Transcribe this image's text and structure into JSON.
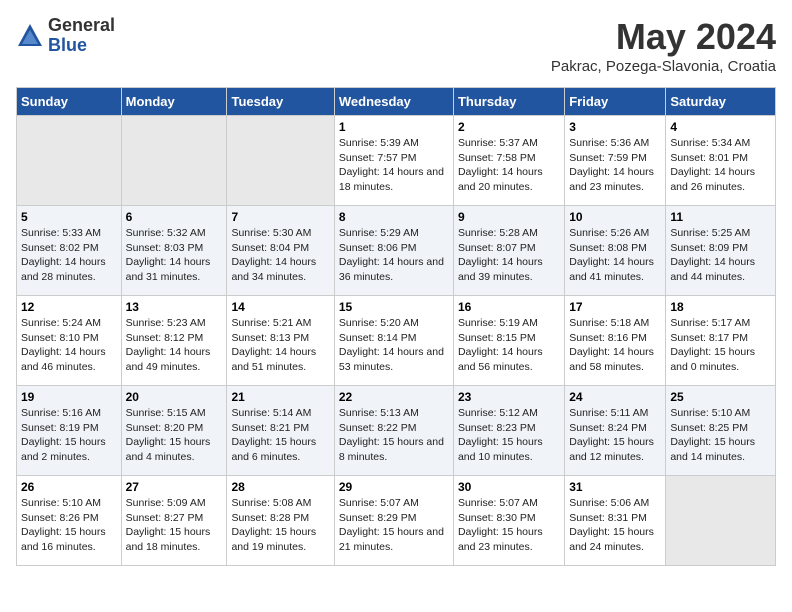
{
  "header": {
    "logo_general": "General",
    "logo_blue": "Blue",
    "title": "May 2024",
    "subtitle": "Pakrac, Pozega-Slavonia, Croatia"
  },
  "days_of_week": [
    "Sunday",
    "Monday",
    "Tuesday",
    "Wednesday",
    "Thursday",
    "Friday",
    "Saturday"
  ],
  "weeks": [
    [
      {
        "day": "",
        "empty": true
      },
      {
        "day": "",
        "empty": true
      },
      {
        "day": "",
        "empty": true
      },
      {
        "day": "1",
        "sunrise": "Sunrise: 5:39 AM",
        "sunset": "Sunset: 7:57 PM",
        "daylight": "Daylight: 14 hours and 18 minutes."
      },
      {
        "day": "2",
        "sunrise": "Sunrise: 5:37 AM",
        "sunset": "Sunset: 7:58 PM",
        "daylight": "Daylight: 14 hours and 20 minutes."
      },
      {
        "day": "3",
        "sunrise": "Sunrise: 5:36 AM",
        "sunset": "Sunset: 7:59 PM",
        "daylight": "Daylight: 14 hours and 23 minutes."
      },
      {
        "day": "4",
        "sunrise": "Sunrise: 5:34 AM",
        "sunset": "Sunset: 8:01 PM",
        "daylight": "Daylight: 14 hours and 26 minutes."
      }
    ],
    [
      {
        "day": "5",
        "sunrise": "Sunrise: 5:33 AM",
        "sunset": "Sunset: 8:02 PM",
        "daylight": "Daylight: 14 hours and 28 minutes."
      },
      {
        "day": "6",
        "sunrise": "Sunrise: 5:32 AM",
        "sunset": "Sunset: 8:03 PM",
        "daylight": "Daylight: 14 hours and 31 minutes."
      },
      {
        "day": "7",
        "sunrise": "Sunrise: 5:30 AM",
        "sunset": "Sunset: 8:04 PM",
        "daylight": "Daylight: 14 hours and 34 minutes."
      },
      {
        "day": "8",
        "sunrise": "Sunrise: 5:29 AM",
        "sunset": "Sunset: 8:06 PM",
        "daylight": "Daylight: 14 hours and 36 minutes."
      },
      {
        "day": "9",
        "sunrise": "Sunrise: 5:28 AM",
        "sunset": "Sunset: 8:07 PM",
        "daylight": "Daylight: 14 hours and 39 minutes."
      },
      {
        "day": "10",
        "sunrise": "Sunrise: 5:26 AM",
        "sunset": "Sunset: 8:08 PM",
        "daylight": "Daylight: 14 hours and 41 minutes."
      },
      {
        "day": "11",
        "sunrise": "Sunrise: 5:25 AM",
        "sunset": "Sunset: 8:09 PM",
        "daylight": "Daylight: 14 hours and 44 minutes."
      }
    ],
    [
      {
        "day": "12",
        "sunrise": "Sunrise: 5:24 AM",
        "sunset": "Sunset: 8:10 PM",
        "daylight": "Daylight: 14 hours and 46 minutes."
      },
      {
        "day": "13",
        "sunrise": "Sunrise: 5:23 AM",
        "sunset": "Sunset: 8:12 PM",
        "daylight": "Daylight: 14 hours and 49 minutes."
      },
      {
        "day": "14",
        "sunrise": "Sunrise: 5:21 AM",
        "sunset": "Sunset: 8:13 PM",
        "daylight": "Daylight: 14 hours and 51 minutes."
      },
      {
        "day": "15",
        "sunrise": "Sunrise: 5:20 AM",
        "sunset": "Sunset: 8:14 PM",
        "daylight": "Daylight: 14 hours and 53 minutes."
      },
      {
        "day": "16",
        "sunrise": "Sunrise: 5:19 AM",
        "sunset": "Sunset: 8:15 PM",
        "daylight": "Daylight: 14 hours and 56 minutes."
      },
      {
        "day": "17",
        "sunrise": "Sunrise: 5:18 AM",
        "sunset": "Sunset: 8:16 PM",
        "daylight": "Daylight: 14 hours and 58 minutes."
      },
      {
        "day": "18",
        "sunrise": "Sunrise: 5:17 AM",
        "sunset": "Sunset: 8:17 PM",
        "daylight": "Daylight: 15 hours and 0 minutes."
      }
    ],
    [
      {
        "day": "19",
        "sunrise": "Sunrise: 5:16 AM",
        "sunset": "Sunset: 8:19 PM",
        "daylight": "Daylight: 15 hours and 2 minutes."
      },
      {
        "day": "20",
        "sunrise": "Sunrise: 5:15 AM",
        "sunset": "Sunset: 8:20 PM",
        "daylight": "Daylight: 15 hours and 4 minutes."
      },
      {
        "day": "21",
        "sunrise": "Sunrise: 5:14 AM",
        "sunset": "Sunset: 8:21 PM",
        "daylight": "Daylight: 15 hours and 6 minutes."
      },
      {
        "day": "22",
        "sunrise": "Sunrise: 5:13 AM",
        "sunset": "Sunset: 8:22 PM",
        "daylight": "Daylight: 15 hours and 8 minutes."
      },
      {
        "day": "23",
        "sunrise": "Sunrise: 5:12 AM",
        "sunset": "Sunset: 8:23 PM",
        "daylight": "Daylight: 15 hours and 10 minutes."
      },
      {
        "day": "24",
        "sunrise": "Sunrise: 5:11 AM",
        "sunset": "Sunset: 8:24 PM",
        "daylight": "Daylight: 15 hours and 12 minutes."
      },
      {
        "day": "25",
        "sunrise": "Sunrise: 5:10 AM",
        "sunset": "Sunset: 8:25 PM",
        "daylight": "Daylight: 15 hours and 14 minutes."
      }
    ],
    [
      {
        "day": "26",
        "sunrise": "Sunrise: 5:10 AM",
        "sunset": "Sunset: 8:26 PM",
        "daylight": "Daylight: 15 hours and 16 minutes."
      },
      {
        "day": "27",
        "sunrise": "Sunrise: 5:09 AM",
        "sunset": "Sunset: 8:27 PM",
        "daylight": "Daylight: 15 hours and 18 minutes."
      },
      {
        "day": "28",
        "sunrise": "Sunrise: 5:08 AM",
        "sunset": "Sunset: 8:28 PM",
        "daylight": "Daylight: 15 hours and 19 minutes."
      },
      {
        "day": "29",
        "sunrise": "Sunrise: 5:07 AM",
        "sunset": "Sunset: 8:29 PM",
        "daylight": "Daylight: 15 hours and 21 minutes."
      },
      {
        "day": "30",
        "sunrise": "Sunrise: 5:07 AM",
        "sunset": "Sunset: 8:30 PM",
        "daylight": "Daylight: 15 hours and 23 minutes."
      },
      {
        "day": "31",
        "sunrise": "Sunrise: 5:06 AM",
        "sunset": "Sunset: 8:31 PM",
        "daylight": "Daylight: 15 hours and 24 minutes."
      },
      {
        "day": "",
        "empty": true
      }
    ]
  ]
}
